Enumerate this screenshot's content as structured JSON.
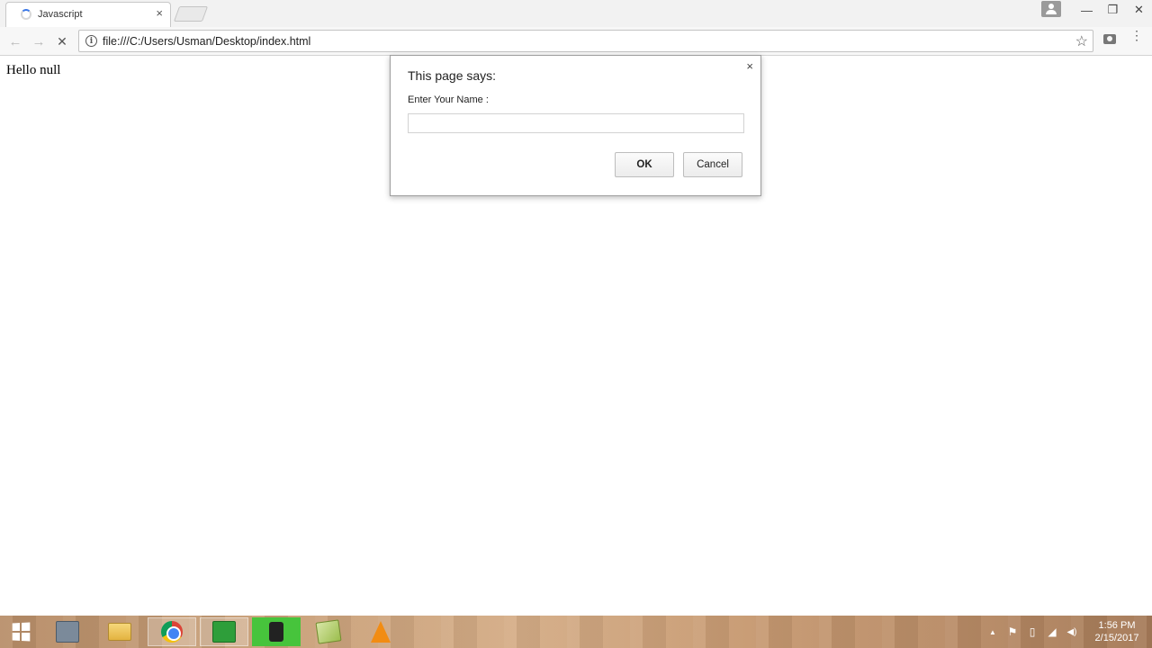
{
  "browser": {
    "tab_title": "Javascript",
    "tab_close": "×",
    "url": "file:///C:/Users/Usman/Desktop/index.html",
    "window_controls": {
      "minimize": "—",
      "restore": "❐",
      "close": "✕"
    }
  },
  "page": {
    "text": "Hello null"
  },
  "dialog": {
    "title": "This page says:",
    "message": "Enter Your Name :",
    "input_value": "",
    "ok_label": "OK",
    "cancel_label": "Cancel",
    "close": "×"
  },
  "taskbar": {
    "time": "1:56 PM",
    "date": "2/15/2017"
  },
  "icons": {
    "back": "←",
    "forward": "→",
    "stop": "✕",
    "info": "i",
    "star": "☆",
    "menu": "⋮",
    "tray_up": "▲",
    "tray_flag": "⚑",
    "tray_battery": "▯",
    "tray_signal": "◢",
    "tray_volume": "◀)"
  },
  "colors": {
    "spinner": "#3b78e7",
    "taskbar": "#c79e77",
    "dialog_border": "#9e9e9e"
  }
}
